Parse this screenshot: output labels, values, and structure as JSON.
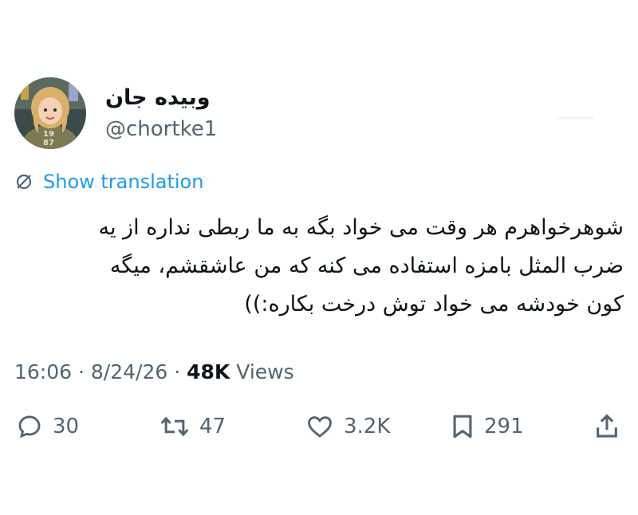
{
  "author": {
    "display_name": "وبیده جان",
    "handle": "@chortke1",
    "avatar_icon": "avatar-illustration-icon",
    "avatar_shirt_text_top": "19",
    "avatar_shirt_text_bottom": "87"
  },
  "translate": {
    "label": "Show translation",
    "icon": "globe-slash-icon"
  },
  "tweet": {
    "text": "شوهرخواهرم هر وقت می خواد بگه به ما ربطی نداره از یه\nضرب المثل بامزه استفاده می کنه که من عاشقشم، میگه\nکون خودشه می خواد توش درخت بکاره:))"
  },
  "meta": {
    "time": "16:06",
    "dot1": "·",
    "date": "8/24/26",
    "dot2": "·",
    "views_count": "48K",
    "views_label": "Views"
  },
  "actions": {
    "reply_count": "30",
    "retweet_count": "47",
    "like_count": "3.2K",
    "bookmark_count": "291"
  },
  "colors": {
    "accent": "#1d9bf0",
    "secondary_text": "#536471",
    "primary_text": "#0f1419"
  }
}
